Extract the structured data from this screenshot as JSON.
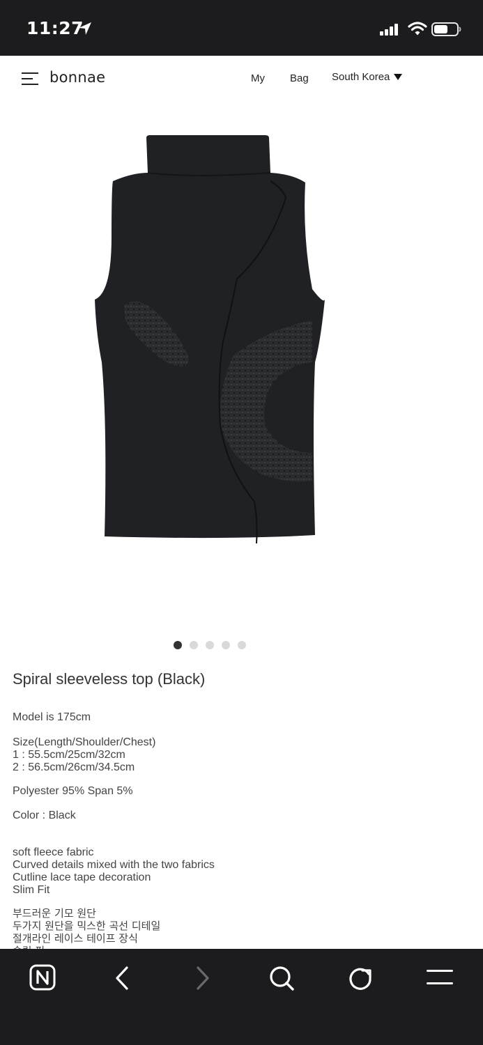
{
  "status_bar": {
    "time": "11:27",
    "icons": [
      "location-arrow-icon",
      "cellular-signal-icon",
      "wifi-icon",
      "battery-icon"
    ]
  },
  "header": {
    "brand": "bonnae",
    "nav": {
      "my": "My",
      "bag": "Bag",
      "country": "South Korea"
    }
  },
  "product": {
    "image_alt": "black sleeveless turtleneck top with curved lace details",
    "carousel": {
      "count": 5,
      "active": 1
    },
    "title": "Spiral sleeveless top (Black)",
    "model": "Model is 175cm",
    "size_header": "Size(Length/Shoulder/Chest)",
    "size_1": "1 : 55.5cm/25cm/32cm",
    "size_2": "2 : 56.5cm/26cm/34.5cm",
    "material": "Polyester 95% Span 5%",
    "color": "Color : Black",
    "features_en": [
      "soft fleece fabric",
      "Curved details mixed with the two fabrics",
      "Cutline lace tape decoration",
      "Slim Fit"
    ],
    "features_ko": [
      "부드러운 기모 원단",
      "두가지 원단을 믹스한 곡선 디테일",
      "절개라인 레이스 테이프 장식",
      "슬림 핏"
    ]
  },
  "bottom_toolbar": {
    "items": [
      "naver-n-icon",
      "back-icon",
      "forward-icon",
      "search-icon",
      "reload-icon",
      "menu-icon"
    ]
  },
  "colors": {
    "system_bar": "#1c1c1e",
    "garment": "#202124",
    "dot_active": "#333333",
    "dot_inactive": "#d9d9d9"
  }
}
